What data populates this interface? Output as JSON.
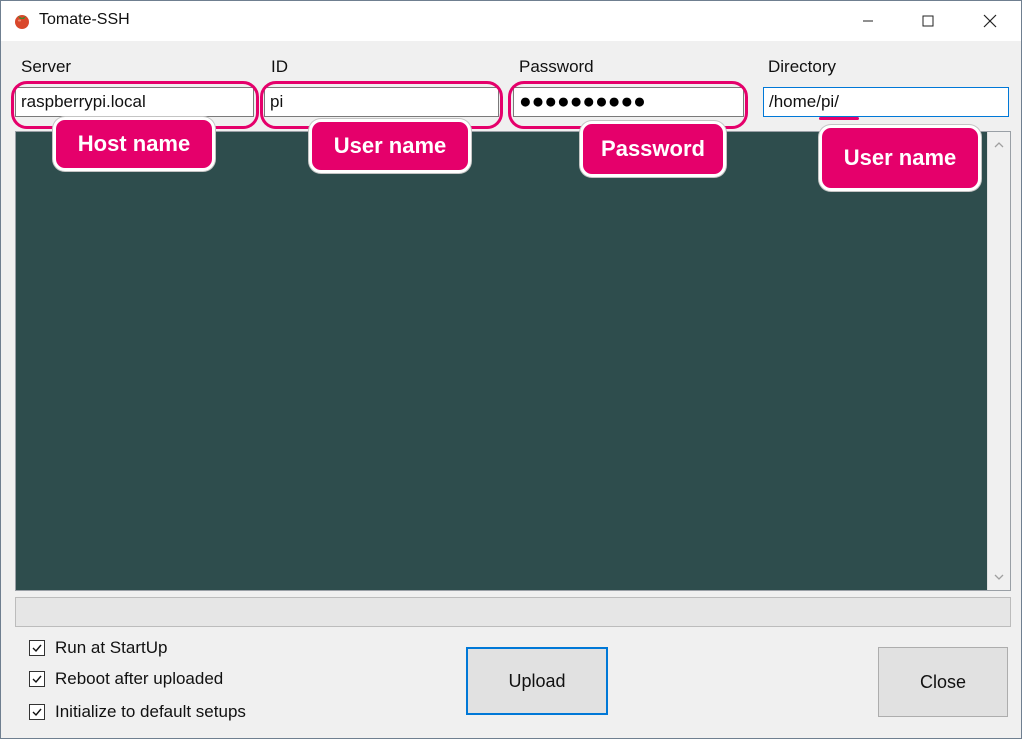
{
  "window": {
    "title": "Tomate-SSH"
  },
  "fields": {
    "server": {
      "label": "Server",
      "value": "raspberrypi.local"
    },
    "id": {
      "label": "ID",
      "value": "pi"
    },
    "password": {
      "label": "Password",
      "masked": "●●●●●●●●●●"
    },
    "directory": {
      "label": "Directory",
      "value": "/home/pi/"
    }
  },
  "options": [
    {
      "label": "Run at StartUp",
      "checked": true
    },
    {
      "label": "Reboot after uploaded",
      "checked": true
    },
    {
      "label": "Initialize to default setups",
      "checked": true
    }
  ],
  "buttons": {
    "upload": "Upload",
    "close": "Close"
  },
  "annotations": {
    "host_name": "Host name",
    "user_name_id": "User name",
    "password": "Password",
    "user_name_dir": "User name"
  },
  "colors": {
    "console_bg": "#2e4d4d",
    "annotation": "#e5006b",
    "focus": "#0078d7"
  }
}
